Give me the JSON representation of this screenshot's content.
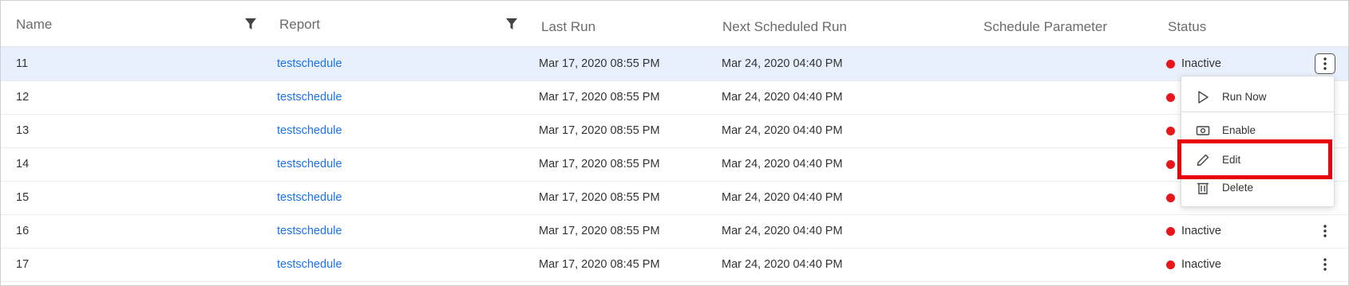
{
  "columns": {
    "name": "Name",
    "report": "Report",
    "last_run": "Last Run",
    "next_run": "Next Scheduled Run",
    "schedule_param": "Schedule Parameter",
    "status": "Status"
  },
  "rows": [
    {
      "name": "11",
      "report": "testschedule",
      "last_run": "Mar 17, 2020 08:55 PM",
      "next_run": "Mar 24, 2020 04:40 PM",
      "status": "Inactive"
    },
    {
      "name": "12",
      "report": "testschedule",
      "last_run": "Mar 17, 2020 08:55 PM",
      "next_run": "Mar 24, 2020 04:40 PM",
      "status": ""
    },
    {
      "name": "13",
      "report": "testschedule",
      "last_run": "Mar 17, 2020 08:55 PM",
      "next_run": "Mar 24, 2020 04:40 PM",
      "status": ""
    },
    {
      "name": "14",
      "report": "testschedule",
      "last_run": "Mar 17, 2020 08:55 PM",
      "next_run": "Mar 24, 2020 04:40 PM",
      "status": ""
    },
    {
      "name": "15",
      "report": "testschedule",
      "last_run": "Mar 17, 2020 08:55 PM",
      "next_run": "Mar 24, 2020 04:40 PM",
      "status": ""
    },
    {
      "name": "16",
      "report": "testschedule",
      "last_run": "Mar 17, 2020 08:55 PM",
      "next_run": "Mar 24, 2020 04:40 PM",
      "status": "Inactive"
    },
    {
      "name": "17",
      "report": "testschedule",
      "last_run": "Mar 17, 2020 08:45 PM",
      "next_run": "Mar 24, 2020 04:40 PM",
      "status": "Inactive"
    }
  ],
  "context_menu": {
    "run_now": "Run Now",
    "enable": "Enable",
    "edit": "Edit",
    "delete": "Delete"
  },
  "colors": {
    "status_inactive": "#e8161b",
    "link": "#1a73e8",
    "selected_row": "#e8f0fd",
    "highlight_box": "#e8000b"
  },
  "icons": {
    "filter": "filter-icon",
    "more": "kebab-icon",
    "run": "play-icon",
    "enable": "camera-icon",
    "edit": "pencil-icon",
    "delete": "trash-icon"
  }
}
